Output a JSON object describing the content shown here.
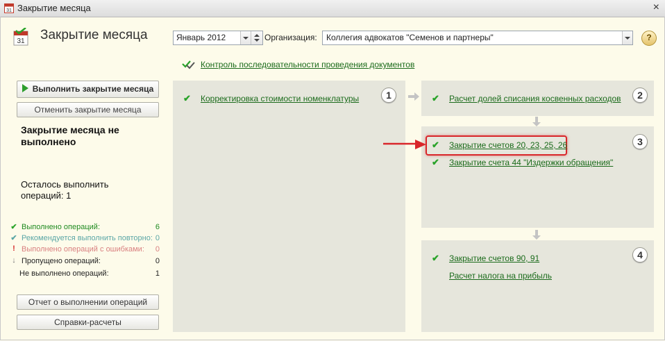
{
  "window": {
    "title": "Закрытие месяца",
    "close_glyph": "×"
  },
  "header": {
    "title": "Закрытие месяца",
    "period_value": "Январь 2012",
    "org_label": "Организация:",
    "org_value": "Коллегия адвокатов \"Семенов и партнеры\"",
    "help_glyph": "?"
  },
  "control_link": "Контроль последовательности проведения документов",
  "left": {
    "run_button": "Выполнить закрытие месяца",
    "cancel_button": "Отменить закрытие месяца",
    "status_title": "Закрытие месяца не выполнено",
    "remaining": "Осталось выполнить операций: 1",
    "stats": [
      {
        "icon": "check-icon",
        "glyph": "✔",
        "label": "Выполнено операций:",
        "value": "6",
        "color": "#1f8a1f"
      },
      {
        "icon": "check-icon",
        "glyph": "✔",
        "label": "Рекомендуется выполнить повторно:",
        "value": "0",
        "color": "#5aa6a6"
      },
      {
        "icon": "error-icon",
        "glyph": "!",
        "label": "Выполнено операций с ошибками:",
        "value": "0",
        "color": "#d98080"
      },
      {
        "icon": "skip-icon",
        "glyph": "↓",
        "label": "Пропущено операций:",
        "value": "0",
        "color": "#222222"
      },
      {
        "icon": "",
        "glyph": "",
        "label": "Не выполнено операций:",
        "value": "1",
        "color": "#222222"
      }
    ],
    "report_button": "Отчет о выполнении операций",
    "calc_button": "Справки-расчеты"
  },
  "steps": {
    "step1": {
      "number": "1",
      "items": [
        "Корректировка стоимости номенклатуры"
      ]
    },
    "step2": {
      "number": "2",
      "items": [
        "Расчет долей списания косвенных расходов"
      ]
    },
    "step3": {
      "number": "3",
      "items": [
        "Закрытие счетов 20, 23, 25, 26",
        "Закрытие счета 44 \"Издержки обращения\""
      ]
    },
    "step4": {
      "number": "4",
      "items": [
        "Закрытие счетов 90, 91",
        "Расчет налога на прибыль"
      ]
    }
  },
  "colors": {
    "link": "#1b6b1b",
    "check": "#2aa32a",
    "highlight": "#d9262a",
    "background": "#fdfbea",
    "panel": "#e6e6dc"
  }
}
